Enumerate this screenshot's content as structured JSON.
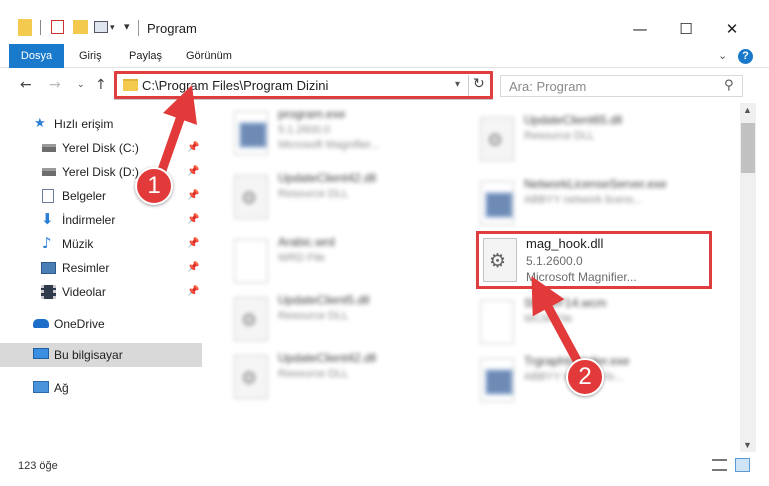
{
  "window": {
    "title": "Program",
    "minimize": "—",
    "maximize": "☐",
    "close": "✕"
  },
  "ribbon": {
    "tabs": [
      "Dosya",
      "Giriş",
      "Paylaş",
      "Görünüm"
    ],
    "help": "?"
  },
  "navigation": {
    "back": "←",
    "forward": "→",
    "recent": "⌄",
    "up": "↑",
    "address": "C:\\Program Files\\Program Dizini",
    "refresh": "↻",
    "search_placeholder": "Ara: Program",
    "search_icon": "⚲"
  },
  "sidebar": {
    "items": [
      {
        "label": "Hızlı erişim",
        "icon": "star-icon"
      },
      {
        "label": "Yerel Disk (C:)",
        "icon": "drive-icon",
        "pinned": true
      },
      {
        "label": "Yerel Disk (D:)",
        "icon": "drive-icon",
        "pinned": true
      },
      {
        "label": "Belgeler",
        "icon": "documents-icon",
        "pinned": true
      },
      {
        "label": "İndirmeler",
        "icon": "downloads-icon",
        "pinned": true
      },
      {
        "label": "Müzik",
        "icon": "music-icon",
        "pinned": true
      },
      {
        "label": "Resimler",
        "icon": "pictures-icon",
        "pinned": true
      },
      {
        "label": "Videolar",
        "icon": "videos-icon",
        "pinned": true
      },
      {
        "label": "OneDrive",
        "icon": "onedrive-icon"
      },
      {
        "label": "Bu bilgisayar",
        "icon": "computer-icon",
        "selected": true
      },
      {
        "label": "Ağ",
        "icon": "network-icon"
      }
    ]
  },
  "files": {
    "left": [
      {
        "name": "program.exe",
        "line1": "5.1.2600.0",
        "line2": "Microsoft Magnifier..."
      },
      {
        "name": "UpdateClient42.dll",
        "line1": "Resource DLL",
        "line2": ""
      },
      {
        "name": "Arabic.wrd",
        "line1": "WRD File",
        "line2": ""
      },
      {
        "name": "UpdateClient5.dll",
        "line1": "Resource DLL",
        "line2": ""
      },
      {
        "name": "UpdateClient42.dll",
        "line1": "Resource DLL",
        "line2": ""
      }
    ],
    "right": [
      {
        "name": "UpdateClient65.dll",
        "line1": "Resource DLL",
        "line2": ""
      },
      {
        "name": "NetworkLicenseServer.exe",
        "line1": "ABBYY network licens...",
        "line2": ""
      },
      {
        "name": "ShAWF14.wcm",
        "line1": "WCM File",
        "line2": ""
      },
      {
        "name": "TrgraphInstaller.exe",
        "line1": "ABBYY Installer fo...",
        "line2": ""
      }
    ],
    "highlighted": {
      "name": "mag_hook.dll",
      "line1": "5.1.2600.0",
      "line2": "Microsoft Magnifier..."
    }
  },
  "status": {
    "count": "123 öğe"
  },
  "callouts": [
    "1",
    "2"
  ],
  "colors": {
    "accent": "#1979ca",
    "highlight": "#e03e3e",
    "callout": "#e23a3a"
  }
}
